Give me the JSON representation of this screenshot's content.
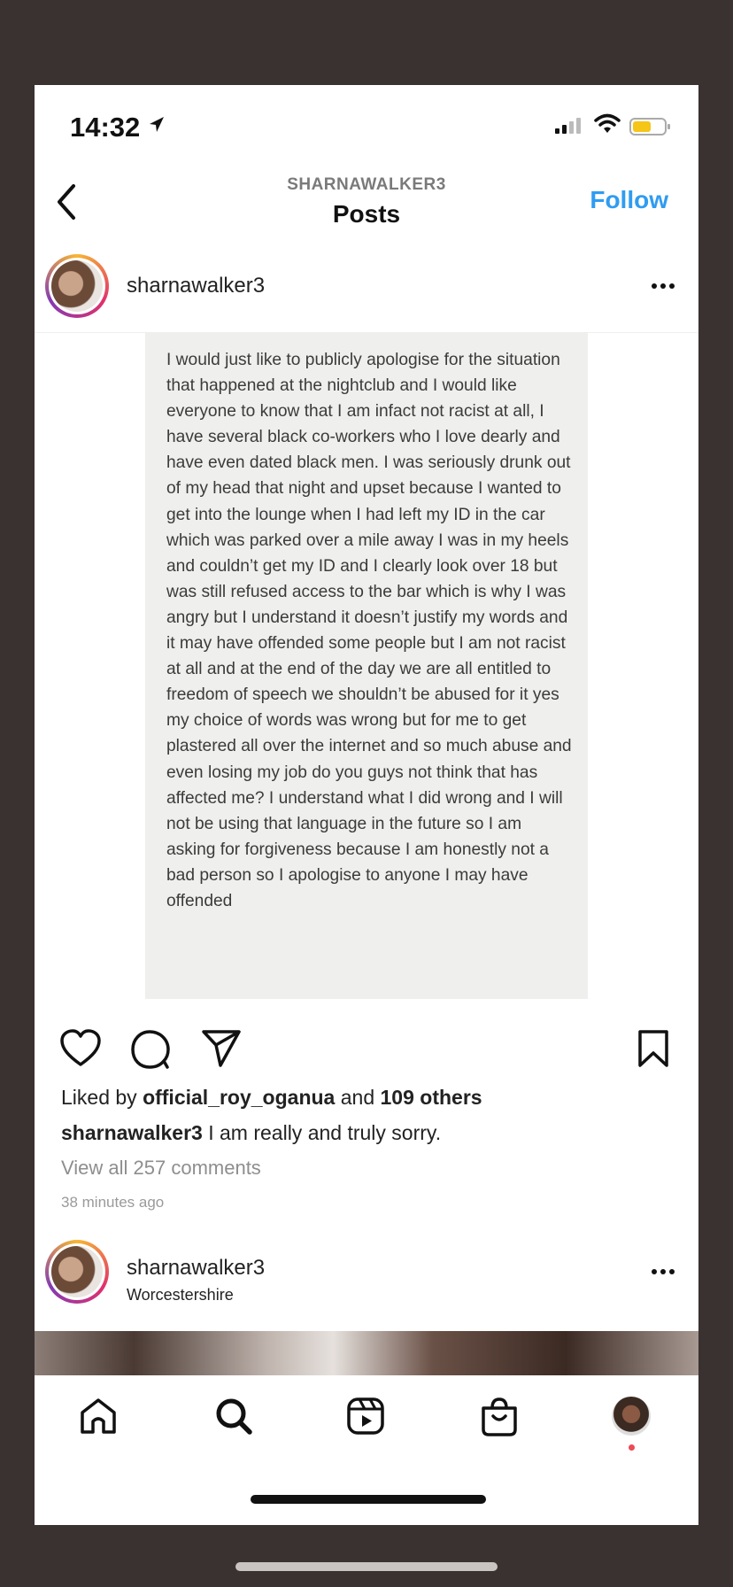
{
  "status_bar": {
    "time": "14:32"
  },
  "header": {
    "subtitle": "SHARNAWALKER3",
    "title": "Posts",
    "follow_label": "Follow"
  },
  "post": {
    "username": "sharnawalker3",
    "image_text": "I would just like to publicly apologise for the situation that happened at the nightclub and I would like everyone to know that I am infact not racist at all, I have several black co-workers who I love dearly and have even dated black men. I was seriously drunk out of my head that night and upset because I wanted to get into the lounge when I had left my ID in the car which was parked over a mile away I was in my heels and couldn’t get my ID and I clearly look over 18 but was still refused access to the bar which is why I was angry but I understand it doesn’t justify my words and it may have offended some people but I am not racist at all and at the end of the day we are all entitled to freedom of speech we shouldn’t be abused for it yes my choice of words was wrong but for me to get plastered all over the internet and so much abuse and even losing my job do you guys not think that has affected me? I understand what I did wrong and I will not be using that language in the future so I am asking for forgiveness because I am honestly not a bad person so I apologise to anyone I may have offended",
    "likes_prefix": "Liked by ",
    "likes_user": "official_roy_oganua",
    "likes_mid": " and ",
    "likes_others": "109 others",
    "caption_user": "sharnawalker3",
    "caption_text": " I am really and truly sorry.",
    "view_comments": "View all 257 comments",
    "time_ago": "38 minutes ago"
  },
  "post2": {
    "username": "sharnawalker3",
    "location": "Worcestershire"
  },
  "colors": {
    "follow": "#2f9cf1",
    "background": "#3a3230",
    "notification_dot": "#ed4956"
  },
  "icons": [
    "location-arrow-icon",
    "signal-icon",
    "wifi-icon",
    "battery-icon",
    "back-chevron-icon",
    "more-icon",
    "heart-icon",
    "comment-icon",
    "share-icon",
    "bookmark-icon",
    "home-icon",
    "search-icon",
    "reels-icon",
    "shop-icon"
  ]
}
